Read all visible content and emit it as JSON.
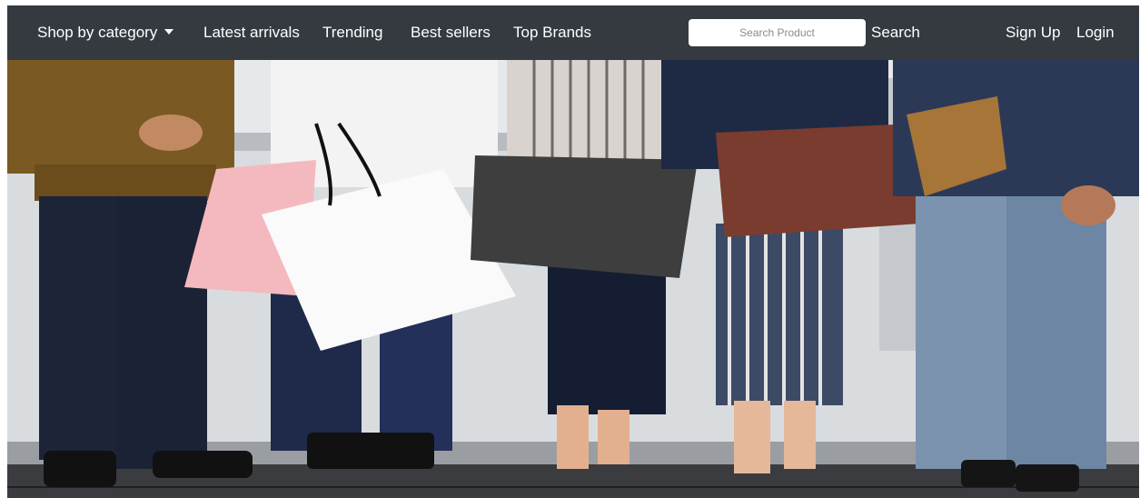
{
  "navbar": {
    "category_label": "Shop by category",
    "links": [
      "Latest arrivals",
      "Trending",
      "Best sellers",
      "Top Brands"
    ],
    "search": {
      "placeholder": "Search Product",
      "button_label": "Search"
    },
    "sign_up": "Sign Up",
    "login": "Login"
  },
  "colors": {
    "navbar_bg": "#343a40",
    "nav_text": "#ffffff"
  },
  "hero": {
    "description_icon": "shopping-bags-photo"
  }
}
